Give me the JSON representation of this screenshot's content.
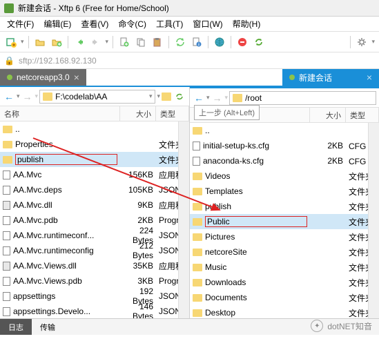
{
  "window": {
    "title": "新建会话 - Xftp 6 (Free for Home/School)"
  },
  "menu": [
    "文件(F)",
    "编辑(E)",
    "查看(V)",
    "命令(C)",
    "工具(T)",
    "窗口(W)",
    "帮助(H)"
  ],
  "address": "sftp://192.168.92.130",
  "tabs": {
    "left": "netcoreapp3.0",
    "right": "新建会话"
  },
  "left": {
    "path": "F:\\codelab\\AA",
    "cols": [
      "名称",
      "大小",
      "类型"
    ],
    "rows": [
      {
        "icon": "folder",
        "name": "..",
        "size": "",
        "type": ""
      },
      {
        "icon": "folder",
        "name": "Properties",
        "size": "",
        "type": "文件夹"
      },
      {
        "icon": "folder",
        "name": "publish",
        "size": "",
        "type": "文件夹",
        "sel": true,
        "boxed": true
      },
      {
        "icon": "file",
        "name": "AA.Mvc",
        "size": "156KB",
        "type": "应用程序"
      },
      {
        "icon": "file",
        "name": "AA.Mvc.deps",
        "size": "105KB",
        "type": "JSON F"
      },
      {
        "icon": "dll",
        "name": "AA.Mvc.dll",
        "size": "9KB",
        "type": "应用程序"
      },
      {
        "icon": "file",
        "name": "AA.Mvc.pdb",
        "size": "2KB",
        "type": "Progra"
      },
      {
        "icon": "file",
        "name": "AA.Mvc.runtimeconf...",
        "size": "224 Bytes",
        "type": "JSON F"
      },
      {
        "icon": "file",
        "name": "AA.Mvc.runtimeconfig",
        "size": "212 Bytes",
        "type": "JSON F"
      },
      {
        "icon": "dll",
        "name": "AA.Mvc.Views.dll",
        "size": "35KB",
        "type": "应用程序"
      },
      {
        "icon": "file",
        "name": "AA.Mvc.Views.pdb",
        "size": "3KB",
        "type": "Progra"
      },
      {
        "icon": "file",
        "name": "appsettings",
        "size": "192 Bytes",
        "type": "JSON F"
      },
      {
        "icon": "file",
        "name": "appsettings.Develo...",
        "size": "146 Bytes",
        "type": "JSON F"
      }
    ]
  },
  "right": {
    "path": "/root",
    "tooltip": "上一步 (Alt+Left)",
    "cols": [
      "名称",
      "大小",
      "类型"
    ],
    "rows": [
      {
        "icon": "folder",
        "name": "..",
        "size": "",
        "type": ""
      },
      {
        "icon": "file",
        "name": "initial-setup-ks.cfg",
        "size": "2KB",
        "type": "CFG 文"
      },
      {
        "icon": "file",
        "name": "anaconda-ks.cfg",
        "size": "2KB",
        "type": "CFG 文"
      },
      {
        "icon": "folder",
        "name": "Videos",
        "size": "",
        "type": "文件夹"
      },
      {
        "icon": "folder",
        "name": "Templates",
        "size": "",
        "type": "文件夹"
      },
      {
        "icon": "folder",
        "name": "publish",
        "size": "",
        "type": "文件夹"
      },
      {
        "icon": "folder",
        "name": "Public",
        "size": "",
        "type": "文件夹",
        "sel": true,
        "boxed": true
      },
      {
        "icon": "folder",
        "name": "Pictures",
        "size": "",
        "type": "文件夹"
      },
      {
        "icon": "folder",
        "name": "netcoreSite",
        "size": "",
        "type": "文件夹"
      },
      {
        "icon": "folder",
        "name": "Music",
        "size": "",
        "type": "文件夹"
      },
      {
        "icon": "folder",
        "name": "Downloads",
        "size": "",
        "type": "文件夹"
      },
      {
        "icon": "folder",
        "name": "Documents",
        "size": "",
        "type": "文件夹"
      },
      {
        "icon": "folder",
        "name": "Desktop",
        "size": "",
        "type": "文件夹"
      }
    ]
  },
  "bottom_tabs": [
    "日志",
    "传输"
  ],
  "watermark": "dotNET知音"
}
